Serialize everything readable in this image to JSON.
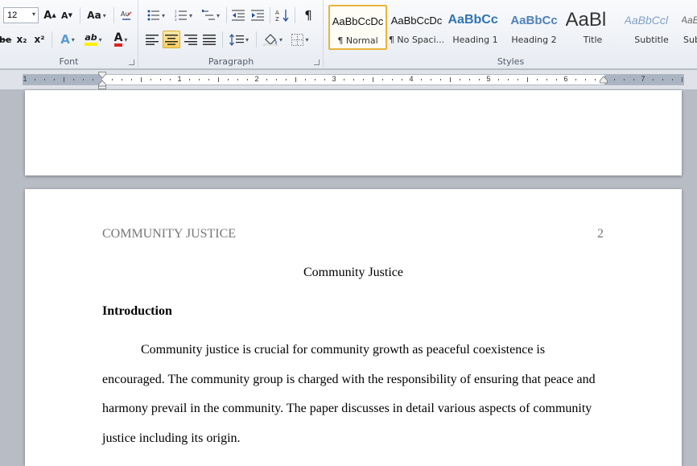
{
  "ribbon": {
    "font_group": {
      "label": "Font",
      "font_size": "12",
      "grow_font": "A",
      "shrink_font": "A",
      "change_case": "Aa",
      "strikethrough": "abe",
      "subscript": "x₂",
      "superscript": "x²",
      "text_effects": "A",
      "highlight": "ab",
      "font_color": "A"
    },
    "paragraph_group": {
      "label": "Paragraph",
      "pilcrow": "¶"
    },
    "styles_group": {
      "label": "Styles",
      "styles": [
        {
          "preview": "AaBbCcDc",
          "name": "¶ Normal"
        },
        {
          "preview": "AaBbCcDc",
          "name": "¶ No Spaci..."
        },
        {
          "preview": "AaBbCc",
          "name": "Heading 1"
        },
        {
          "preview": "AaBbCc",
          "name": "Heading 2"
        },
        {
          "preview": "AaBl",
          "name": "Title"
        },
        {
          "preview": "AaBbCcl",
          "name": "Subtitle"
        },
        {
          "preview": "AaBl",
          "name": "Sub"
        }
      ]
    }
  },
  "ruler": {
    "numbers": [
      "1",
      "1",
      "2",
      "3",
      "4",
      "5",
      "6",
      "7"
    ]
  },
  "document": {
    "running_head": "COMMUNITY JUSTICE",
    "page_number": "2",
    "title": "Community Justice",
    "heading": "Introduction",
    "paragraph_lines": [
      "Community justice is crucial for community growth as peaceful coexistence is",
      "encouraged. The community group is charged with the responsibility of ensuring that peace and",
      "harmony prevail in the community. The paper discusses in detail various aspects of community",
      "justice including its origin."
    ]
  },
  "colors": {
    "accent_selected": "#f8cf5e",
    "heading_blue": "#2e74b5",
    "running_head_gray": "#777777"
  }
}
